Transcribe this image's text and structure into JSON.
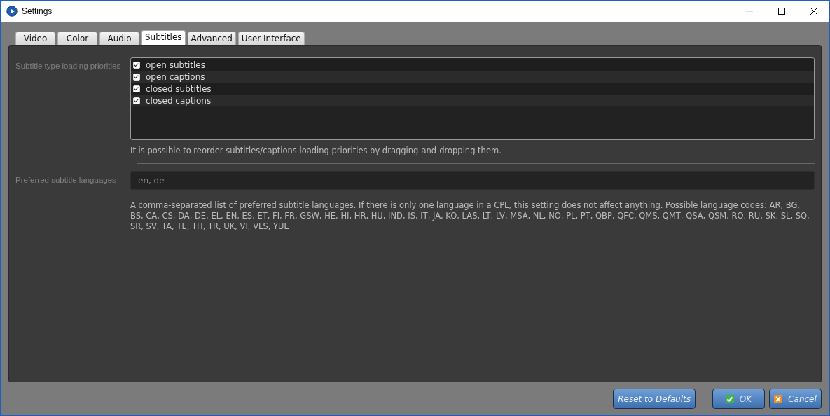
{
  "window": {
    "title": "Settings"
  },
  "tabs": [
    {
      "label": "Video",
      "selected": false
    },
    {
      "label": "Color",
      "selected": false
    },
    {
      "label": "Audio",
      "selected": false
    },
    {
      "label": "Subtitles",
      "selected": true
    },
    {
      "label": "Advanced",
      "selected": false
    },
    {
      "label": "User Interface",
      "selected": false
    }
  ],
  "subtitle_priorities": {
    "label": "Subtitle type loading priorities",
    "items": [
      {
        "label": "open subtitles",
        "checked": true
      },
      {
        "label": "open captions",
        "checked": true
      },
      {
        "label": "closed subtitles",
        "checked": true
      },
      {
        "label": "closed captions",
        "checked": true
      }
    ],
    "hint": "It is possible to reorder subtitles/captions loading priorities by dragging-and-dropping them."
  },
  "preferred_languages": {
    "label": "Preferred subtitle languages",
    "value": "en, de",
    "hint": "A comma-separated list of preferred subtitle languages. If there is only one language in a CPL, this setting does not affect anything. Possible language codes: AR, BG, BS, CA, CS, DA, DE, EL, EN, ES, ET, FI, FR, GSW, HE, HI, HR, HU, IND, IS, IT, JA, KO, LAS, LT, LV, MSA, NL, NO, PL, PT, QBP, QFC, QMS, QMT, QSA, QSM, RO, RU, SK, SL, SQ, SR, SV, TA, TE, TH, TR, UK, VI, VLS, YUE"
  },
  "buttons": [
    {
      "label": "Reset to Defaults",
      "kind": "reset"
    },
    {
      "label": "OK",
      "kind": "ok"
    },
    {
      "label": "Cancel",
      "kind": "cancel"
    }
  ]
}
